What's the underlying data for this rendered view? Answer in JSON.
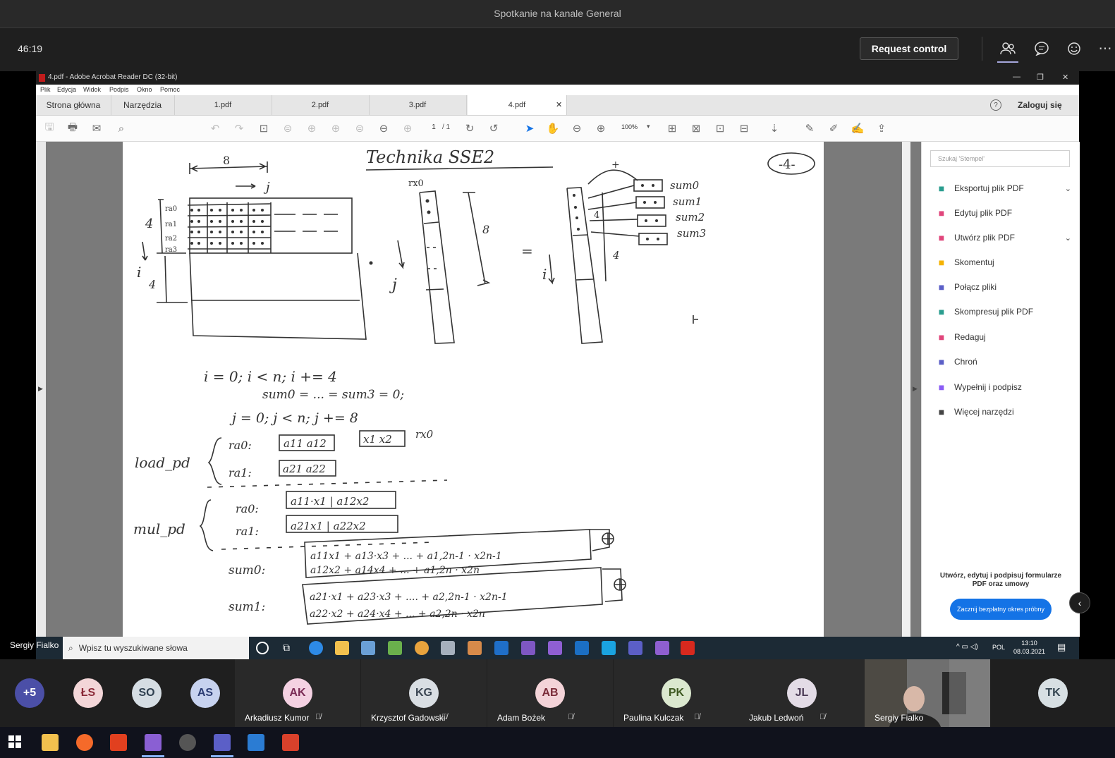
{
  "teams": {
    "meeting_title": "Spotkanie na kanale General",
    "call_timer": "46:19",
    "request_control_label": "Request control",
    "header_icons": [
      "people-icon",
      "chat-icon",
      "reactions-icon",
      "more-icon"
    ]
  },
  "acrobat": {
    "window_title": "4.pdf - Adobe Acrobat Reader DC (32-bit)",
    "menu": [
      "Plik",
      "Edycja",
      "Widok",
      "Podpis",
      "Okno",
      "Pomoc"
    ],
    "tabs": [
      "Strona główna",
      "Narzędzia",
      "1.pdf",
      "2.pdf",
      "3.pdf",
      "4.pdf"
    ],
    "sign_in_label": "Zaloguj się",
    "page_current": "1",
    "page_total": "/ 1",
    "zoom": "100%",
    "search_placeholder": "Szukaj 'Stempel'",
    "tools": [
      {
        "label": "Eksportuj plik PDF",
        "icon": "export-pdf-icon",
        "color": "#2a9d8f",
        "chevron": true
      },
      {
        "label": "Edytuj plik PDF",
        "icon": "edit-pdf-icon",
        "color": "#e0457b",
        "chevron": false
      },
      {
        "label": "Utwórz plik PDF",
        "icon": "create-pdf-icon",
        "color": "#e0457b",
        "chevron": true
      },
      {
        "label": "Skomentuj",
        "icon": "comment-icon",
        "color": "#f5b301",
        "chevron": false
      },
      {
        "label": "Połącz pliki",
        "icon": "combine-files-icon",
        "color": "#5b5fc7",
        "chevron": false
      },
      {
        "label": "Skompresuj plik PDF",
        "icon": "compress-pdf-icon",
        "color": "#2a9d8f",
        "chevron": false
      },
      {
        "label": "Redaguj",
        "icon": "redact-icon",
        "color": "#e0457b",
        "chevron": false
      },
      {
        "label": "Chroń",
        "icon": "protect-icon",
        "color": "#5b5fc7",
        "chevron": false
      },
      {
        "label": "Wypełnij i podpisz",
        "icon": "fill-sign-icon",
        "color": "#8a5cf5",
        "chevron": false
      },
      {
        "label": "Więcej narzędzi",
        "icon": "more-tools-icon",
        "color": "#444444",
        "chevron": false
      }
    ],
    "promo_text": "Utwórz, edytuj i podpisuj formularze PDF oraz umowy",
    "trial_button": "Zacznij bezpłatny okres próbny"
  },
  "pdf_page": {
    "title": "Technika SSE2",
    "page_marker": "-4-",
    "labels": {
      "width8": "8",
      "j_arrow": "j",
      "height4": "4",
      "i_label": "i",
      "i4": "4",
      "ra0": "ra0",
      "ra1": "ra1",
      "ra2": "ra2",
      "ra3": "ra3",
      "rx0": "rx0",
      "vec8": "8",
      "j_label": "j",
      "equals": "=",
      "i_label2": "i",
      "plus": "+",
      "sum0": "sum0",
      "sum1": "sum1",
      "sum2": "sum2",
      "sum3": "sum3",
      "four_a": "4",
      "four_b": "4"
    },
    "code_lines": [
      "i = 0; i < n; i += 4",
      "sum0 = ... = sum3 = 0;",
      "j = 0; j < n; j += 8"
    ],
    "load_pd": "load_pd",
    "load_rows": [
      {
        "reg": "ra0:",
        "cells": "a11  a12",
        "x": "x1  x2",
        "dst": "rx0"
      },
      {
        "reg": "ra1:",
        "cells": "a21  a22"
      }
    ],
    "mul_pd": "mul_pd",
    "mul_rows": [
      {
        "reg": "ra0:",
        "cells": "a11·x1 | a12x2"
      },
      {
        "reg": "ra1:",
        "cells": "a21x1 | a22x2"
      }
    ],
    "sum0_label": "sum0:",
    "sum0_lines": [
      "a11x1 + a13·x3 + ... + a1,2n-1 · x2n-1",
      "a12x2 + a14x4 + ... + a1,2n · x2n"
    ],
    "sum1_label": "sum1:",
    "sum1_lines": [
      "a21·x1 + a23·x3 + .... + a2,2n-1 · x2n-1",
      "a22·x2 + a24·x4 + ... + a2,2n · x2n"
    ]
  },
  "shared_taskbar": {
    "search_placeholder": "Wpisz tu wyszukiwane słowa",
    "lang": "POL",
    "time": "13:10",
    "date": "08.03.2021"
  },
  "presenter_name": "Sergiy Fialko",
  "participants": {
    "overflow": "+5",
    "bubbles": [
      {
        "initials": "ŁS",
        "bg": "#f3d6d8",
        "fg": "#8b2a38"
      },
      {
        "initials": "SO",
        "bg": "#d5dde3",
        "fg": "#2f4050"
      },
      {
        "initials": "AS",
        "bg": "#c7d2ef",
        "fg": "#2a3b73"
      }
    ],
    "tiles": [
      {
        "initials": "AK",
        "name": "Arkadiusz Kumor",
        "bg": "#f4d1e2",
        "fg": "#7a2a55"
      },
      {
        "initials": "KG",
        "name": "Krzysztof Gadowski",
        "bg": "#d9dee3",
        "fg": "#3a4552"
      },
      {
        "initials": "AB",
        "name": "Adam Bożek",
        "bg": "#f3d3d8",
        "fg": "#7a2b38"
      },
      {
        "initials": "PK",
        "name": "Paulina Kulczak",
        "bg": "#dbe8cf",
        "fg": "#3f5a22"
      },
      {
        "initials": "JL",
        "name": "Jakub Ledwoń",
        "bg": "#e3dce6",
        "fg": "#4b3b55"
      }
    ],
    "video_name": "Sergiy Fialko",
    "last": {
      "initials": "TK",
      "bg": "#d7dfe3",
      "fg": "#334450"
    }
  }
}
